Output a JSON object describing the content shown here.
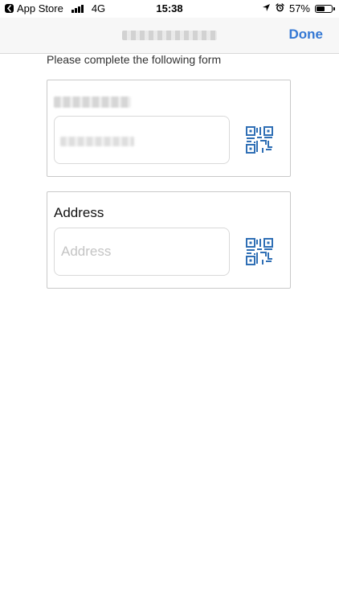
{
  "status_bar": {
    "back_app": "App Store",
    "network": "4G",
    "time": "15:38",
    "battery_percent": "57%",
    "battery_level": 0.57,
    "icons": [
      "back-icon",
      "signal-icon",
      "location-icon",
      "alarm-icon",
      "battery-icon"
    ]
  },
  "nav": {
    "title": "",
    "done_label": "Done"
  },
  "form": {
    "instruction": "Please complete the following form",
    "fields": [
      {
        "label": "",
        "placeholder": "",
        "value": "",
        "scan_icon": "qr-code-icon"
      },
      {
        "label": "Address",
        "placeholder": "Address",
        "value": "",
        "scan_icon": "qr-code-icon"
      }
    ]
  },
  "colors": {
    "accent": "#3478d4",
    "qr_icon": "#2f6fb5"
  }
}
